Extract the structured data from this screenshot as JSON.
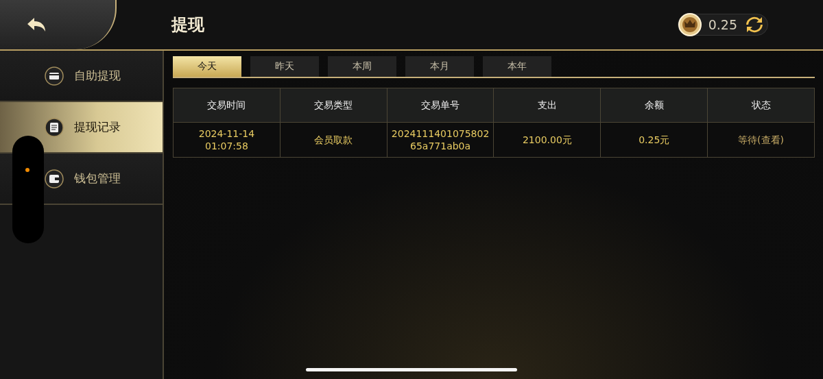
{
  "header": {
    "title": "提现",
    "balance": "0.25"
  },
  "sidebar": {
    "items": [
      {
        "label": "自助提现",
        "kind": "card",
        "selected": false
      },
      {
        "label": "提现记录",
        "kind": "record",
        "selected": true
      },
      {
        "label": "钱包管理",
        "kind": "wallet",
        "selected": false
      }
    ]
  },
  "tabs": [
    {
      "label": "今天",
      "selected": true
    },
    {
      "label": "昨天",
      "selected": false
    },
    {
      "label": "本周",
      "selected": false
    },
    {
      "label": "本月",
      "selected": false
    },
    {
      "label": "本年",
      "selected": false
    }
  ],
  "table": {
    "columns": [
      "交易时间",
      "交易类型",
      "交易单号",
      "支出",
      "余额",
      "状态"
    ],
    "rows": [
      [
        "2024-11-14\n01:07:58",
        "会员取款",
        "2024111401075802\n65a771ab0a",
        "2100.00元",
        "0.25元",
        "等待(查看)"
      ]
    ]
  }
}
